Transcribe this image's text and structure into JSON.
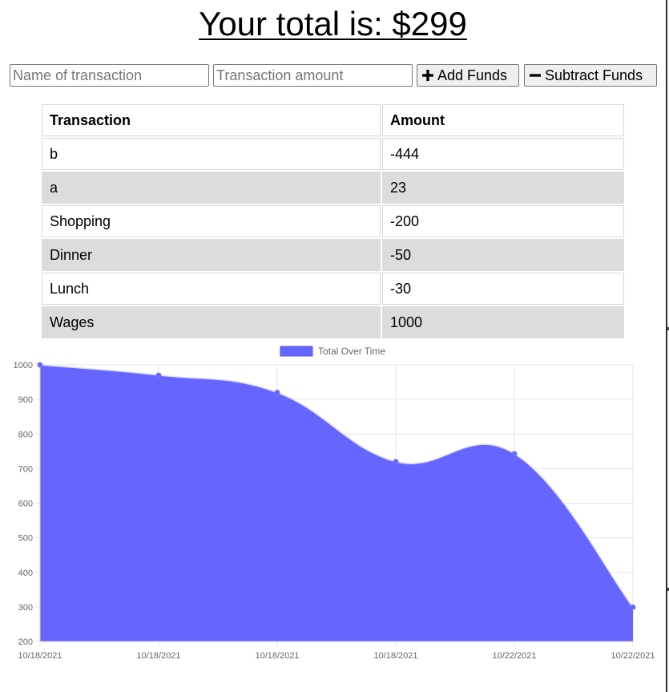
{
  "header": {
    "title": "Your total is: $299"
  },
  "form": {
    "name_placeholder": "Name of transaction",
    "amount_placeholder": "Transaction amount",
    "add_label": "Add Funds",
    "subtract_label": "Subtract Funds",
    "add_icon": "plus-icon",
    "subtract_icon": "minus-icon"
  },
  "table": {
    "headers": [
      "Transaction",
      "Amount"
    ],
    "rows": [
      {
        "name": "b",
        "amount": "-444"
      },
      {
        "name": "a",
        "amount": "23"
      },
      {
        "name": "Shopping",
        "amount": "-200"
      },
      {
        "name": "Dinner",
        "amount": "-50"
      },
      {
        "name": "Lunch",
        "amount": "-30"
      },
      {
        "name": "Wages",
        "amount": "1000"
      }
    ],
    "stripe_color": "#dcdcdc"
  },
  "chart_data": {
    "type": "area",
    "series": [
      {
        "name": "Total Over Time",
        "values": [
          1000,
          970,
          920,
          720,
          743,
          299
        ],
        "color": "#6666ff"
      }
    ],
    "categories": [
      "10/18/2021",
      "10/18/2021",
      "10/18/2021",
      "10/18/2021",
      "10/22/2021",
      "10/22/2021"
    ],
    "ylim": [
      200,
      1000
    ],
    "yticks": [
      "1000",
      "900",
      "800",
      "700",
      "600",
      "500",
      "400",
      "300",
      "200"
    ],
    "grid": true,
    "legend": "top-center"
  }
}
